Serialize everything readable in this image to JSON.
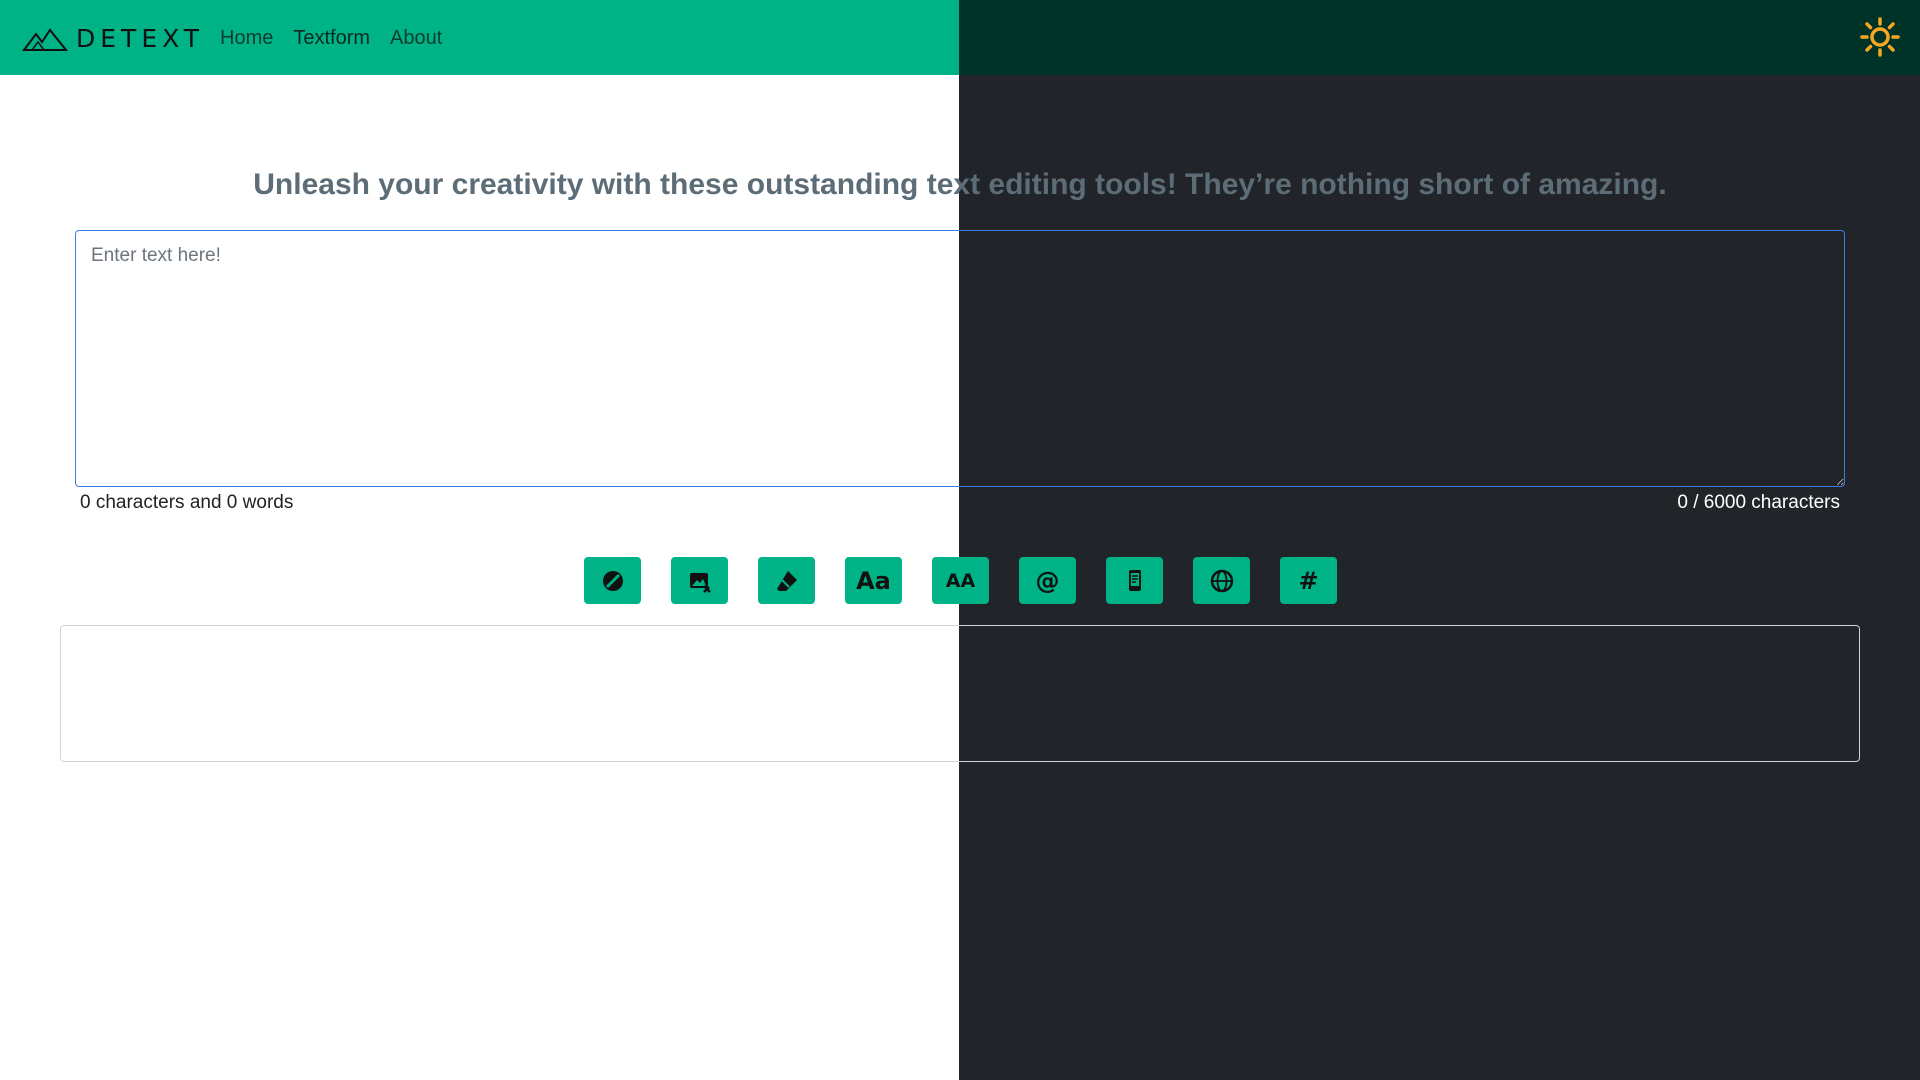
{
  "navbar": {
    "brand": "DETEXT",
    "links": [
      {
        "label": "Home",
        "active": false
      },
      {
        "label": "Textform",
        "active": true
      },
      {
        "label": "About",
        "active": false
      }
    ],
    "theme_toggle_icon": "sun-icon"
  },
  "colors": {
    "accent": "#00b386",
    "nav_dark": "#003327",
    "dark_bg": "#212529",
    "headline": "#5d6d78",
    "toggle": "#f5a623"
  },
  "headline": "Unleash your creativity with these outstanding text editing tools! They’re nothing short of amazing.",
  "editor": {
    "placeholder": "Enter text here!",
    "value": "",
    "summary": "0 characters and 0 words",
    "limit_text": "0 / 6000 characters"
  },
  "tools": [
    {
      "icon": "block-icon"
    },
    {
      "icon": "image-edit-icon"
    },
    {
      "icon": "eraser-icon"
    },
    {
      "icon": "capitalize-icon",
      "glyph": "Aa"
    },
    {
      "icon": "uppercase-icon",
      "glyph": "AA"
    },
    {
      "icon": "email-icon",
      "glyph": "@"
    },
    {
      "icon": "phone-icon"
    },
    {
      "icon": "url-icon"
    },
    {
      "icon": "hashtag-icon",
      "glyph": "#"
    }
  ],
  "output": {
    "text": ""
  }
}
